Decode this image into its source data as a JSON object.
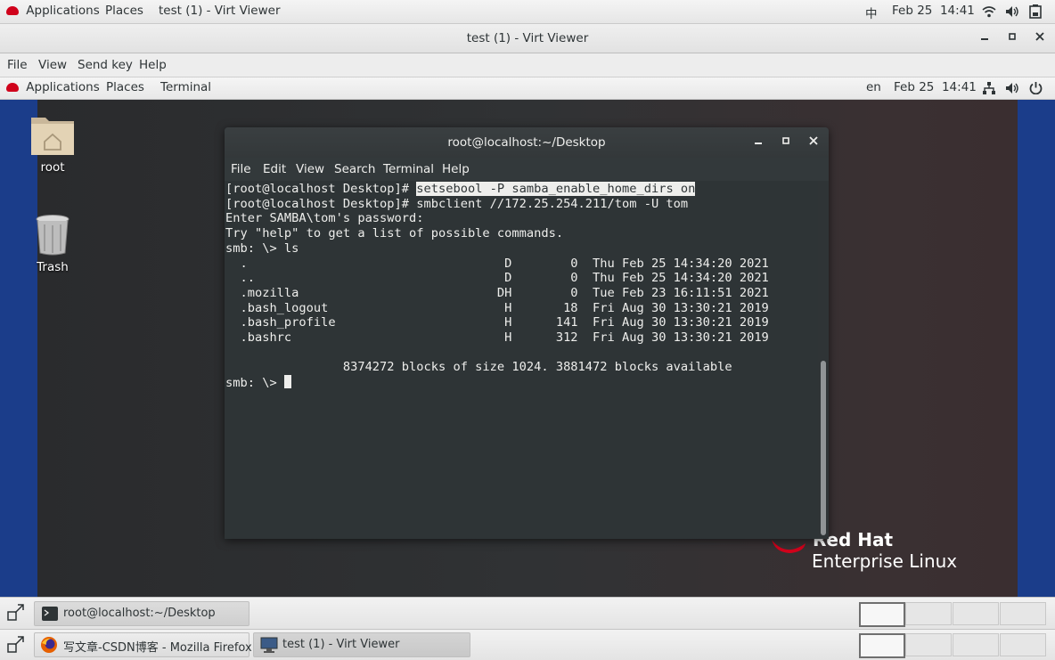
{
  "host_topbar": {
    "applications": "Applications",
    "places": "Places",
    "window_title": "test (1) - Virt Viewer",
    "input_method": "中",
    "date": "Feb 25",
    "time": "14:41"
  },
  "virt_viewer": {
    "title": "test (1) - Virt Viewer",
    "menu": [
      "File",
      "View",
      "Send key",
      "Help"
    ]
  },
  "guest_topbar": {
    "applications": "Applications",
    "places": "Places",
    "terminal": "Terminal",
    "lang": "en",
    "date": "Feb 25",
    "time": "14:41"
  },
  "desktop_icons": {
    "home": "root",
    "trash": "Trash"
  },
  "terminal": {
    "title": "root@localhost:~/Desktop",
    "menu": [
      "File",
      "Edit",
      "View",
      "Search",
      "Terminal",
      "Help"
    ],
    "lines": [
      {
        "prompt": "[root@localhost Desktop]# ",
        "cmd": "setsebool -P samba_enable_home_dirs on"
      },
      {
        "text": "[root@localhost Desktop]# smbclient //172.25.254.211/tom -U tom"
      },
      {
        "text": "Enter SAMBA\\tom's password:"
      },
      {
        "text": "Try \"help\" to get a list of possible commands."
      },
      {
        "text": "smb: \\> ls"
      },
      {
        "text": "  .                                   D        0  Thu Feb 25 14:34:20 2021"
      },
      {
        "text": "  ..                                  D        0  Thu Feb 25 14:34:20 2021"
      },
      {
        "text": "  .mozilla                           DH        0  Tue Feb 23 16:11:51 2021"
      },
      {
        "text": "  .bash_logout                        H       18  Fri Aug 30 13:30:21 2019"
      },
      {
        "text": "  .bash_profile                       H      141  Fri Aug 30 13:30:21 2019"
      },
      {
        "text": "  .bashrc                             H      312  Fri Aug 30 13:30:21 2019"
      },
      {
        "text": ""
      },
      {
        "text": "                8374272 blocks of size 1024. 3881472 blocks available"
      },
      {
        "prompt": "smb: \\> ",
        "cursor": true
      }
    ]
  },
  "branding": {
    "line1": "Red Hat",
    "line2": "Enterprise Linux"
  },
  "guest_taskbar": {
    "task": "root@localhost:~/Desktop"
  },
  "host_taskbar": {
    "tasks": [
      "写文章-CSDN博客 - Mozilla Firefox",
      "test (1) - Virt Viewer"
    ]
  },
  "colors": {
    "terminal_bg": "#2e3436",
    "terminal_fg": "#eeeeec",
    "desktop_blue": "#1b3d8a",
    "redhat_red": "#d0021b"
  }
}
